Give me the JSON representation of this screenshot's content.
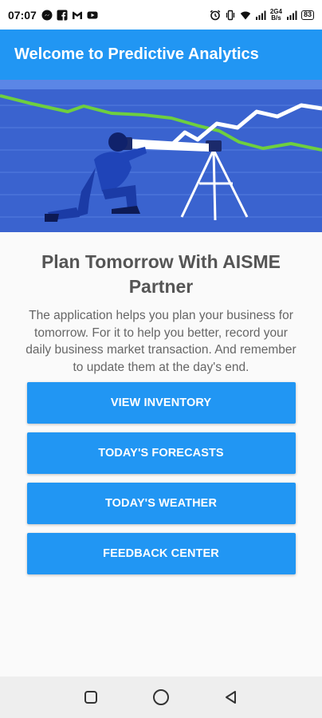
{
  "status_bar": {
    "time": "07:07",
    "network_top": "2G4",
    "network_bottom": "B/s",
    "battery": "83"
  },
  "app_bar": {
    "title": "Welcome to Predictive Analytics"
  },
  "main": {
    "heading": "Plan Tomorrow With AISME Partner",
    "description": "The application helps you plan your business for tomorrow. For it to help you better, record your daily business market transaction. And remember to update them at the day's end.",
    "buttons": [
      {
        "label": "VIEW INVENTORY"
      },
      {
        "label": "TODAY'S FORECASTS"
      },
      {
        "label": "TODAY'S WEATHER"
      },
      {
        "label": "FEEDBACK CENTER"
      }
    ]
  },
  "colors": {
    "primary": "#2196f3",
    "hero_bg": "#3a63cf",
    "trend_green": "#6ecf3f"
  },
  "icons": {
    "status_left": [
      "messenger-icon",
      "facebook-icon",
      "gmail-icon",
      "youtube-icon"
    ],
    "status_right": [
      "alarm-icon",
      "vibrate-icon",
      "wifi-icon",
      "signal-icon",
      "signal-icon",
      "battery-icon"
    ],
    "nav": [
      "recents-icon",
      "home-icon",
      "back-icon"
    ]
  }
}
